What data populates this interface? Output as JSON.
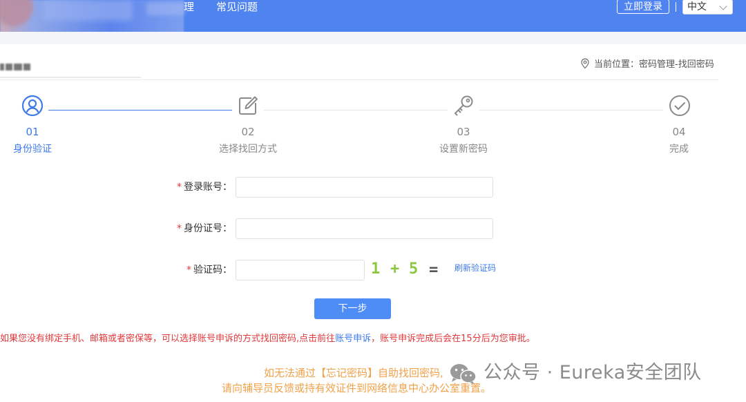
{
  "header": {
    "nav_fragment": "理",
    "nav_faq": "常见问题",
    "login_label": "立即登录",
    "language": "中文"
  },
  "breadcrumb": {
    "text": "当前位置：密码管理-找回密码"
  },
  "steps": [
    {
      "number": "01",
      "label": "身份验证",
      "state": "active",
      "icon": "user-circle-icon"
    },
    {
      "number": "02",
      "label": "选择找回方式",
      "state": "pending",
      "icon": "edit-icon"
    },
    {
      "number": "03",
      "label": "设置新密码",
      "state": "pending",
      "icon": "key-icon"
    },
    {
      "number": "04",
      "label": "完成",
      "state": "pending",
      "icon": "check-circle-icon"
    }
  ],
  "form": {
    "account_label": "登录账号：",
    "account_value": "",
    "id_label": "身份证号：",
    "id_value": "",
    "captcha_label": "验证码：",
    "captcha_value": "",
    "captcha_a": "1",
    "captcha_op": "+",
    "captcha_b": "5",
    "captcha_eq": "=",
    "refresh_label": "刷新验证码",
    "required_mark": "*",
    "next_label": "下一步"
  },
  "notice": {
    "before_link": "如果您没有绑定手机、邮箱或者密保等，可以选择账号申诉的方式找回密码,点击前往",
    "link": "账号申诉",
    "after_link": "，账号申诉完成后会在15分后为您审批。"
  },
  "footer": {
    "line1": "如无法通过【忘记密码】自助找回密码,",
    "line2": "请向辅导员反馈或持有效证件到网络信息中心办公室重置。"
  },
  "watermark": {
    "text": "公众号 · Eureka安全团队",
    "icon": "wechat-icon"
  },
  "colors": {
    "header_bg": "#4f83f0",
    "active": "#3e7bea",
    "pending": "#888888",
    "required": "#e23b3b",
    "button": "#4e8df6",
    "notice": "#e0393b",
    "footer": "#f0a24a",
    "captcha_digit": "#8dc63f",
    "captcha_symbol": "#555555"
  }
}
